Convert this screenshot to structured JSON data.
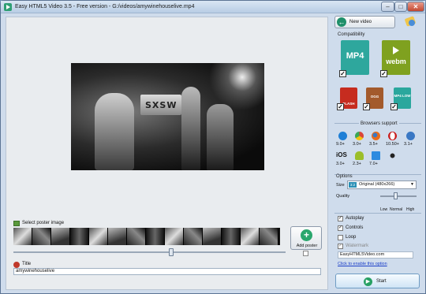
{
  "window": {
    "title": "Easy HTML5 Video 3.5  - Free version - G:/videos/amywinehouselive.mp4",
    "min_label": "–",
    "max_label": "□",
    "close_label": "✕"
  },
  "preview": {
    "sign_text": "SXSW"
  },
  "poster": {
    "label": "Select poster image",
    "add_label": "Add poster",
    "add_icon": "+"
  },
  "title": {
    "label": "Title",
    "value": "amywinehouselive"
  },
  "toolbar": {
    "new_video_label": "New video",
    "new_video_icon": "←"
  },
  "compatibility": {
    "label": "Compatibility",
    "formats": [
      {
        "name": "MP4",
        "checked": true
      },
      {
        "name": "webm",
        "checked": true
      },
      {
        "name": "FLASH",
        "checked": true
      },
      {
        "name": "OGG",
        "checked": true
      },
      {
        "name": "MP4 LOW",
        "checked": true
      }
    ]
  },
  "browsers": {
    "label": "Browsers support",
    "items": [
      {
        "name": "ie-icon",
        "version": "9.0+",
        "color": "#1e7fd6"
      },
      {
        "name": "chrome-icon",
        "version": "3.0+",
        "color": "#d9463a"
      },
      {
        "name": "firefox-icon",
        "version": "3.5+",
        "color": "#e86b1c"
      },
      {
        "name": "opera-icon",
        "version": "10.50+",
        "color": "#c91b1b"
      },
      {
        "name": "safari-icon",
        "version": "3.1+",
        "color": "#3a78c4"
      },
      {
        "name": "ios-icon",
        "label": "iOS",
        "version": "3.0+",
        "color": "#111111"
      },
      {
        "name": "android-icon",
        "version": "2.3+",
        "color": "#9bbe2a"
      },
      {
        "name": "windows-icon",
        "version": "7.0+",
        "color": "#2d8be0"
      },
      {
        "name": "blackberry-icon",
        "version": "",
        "color": "#222222"
      }
    ]
  },
  "options": {
    "label": "Options",
    "size_label": "Size",
    "size_tag": "3:2",
    "size_value": "Original (480x266)",
    "quality_label": "Quality",
    "quality_ticks": [
      "Low",
      "Normal",
      "High"
    ],
    "autoplay_label": "Autoplay",
    "controls_label": "Controls",
    "loop_label": "Loop",
    "watermark_label": "Watermark",
    "watermark_value": "EasyHTML5Video.com",
    "enable_link": "Click to enable this option"
  },
  "start": {
    "label": "Start",
    "icon": "▶"
  }
}
